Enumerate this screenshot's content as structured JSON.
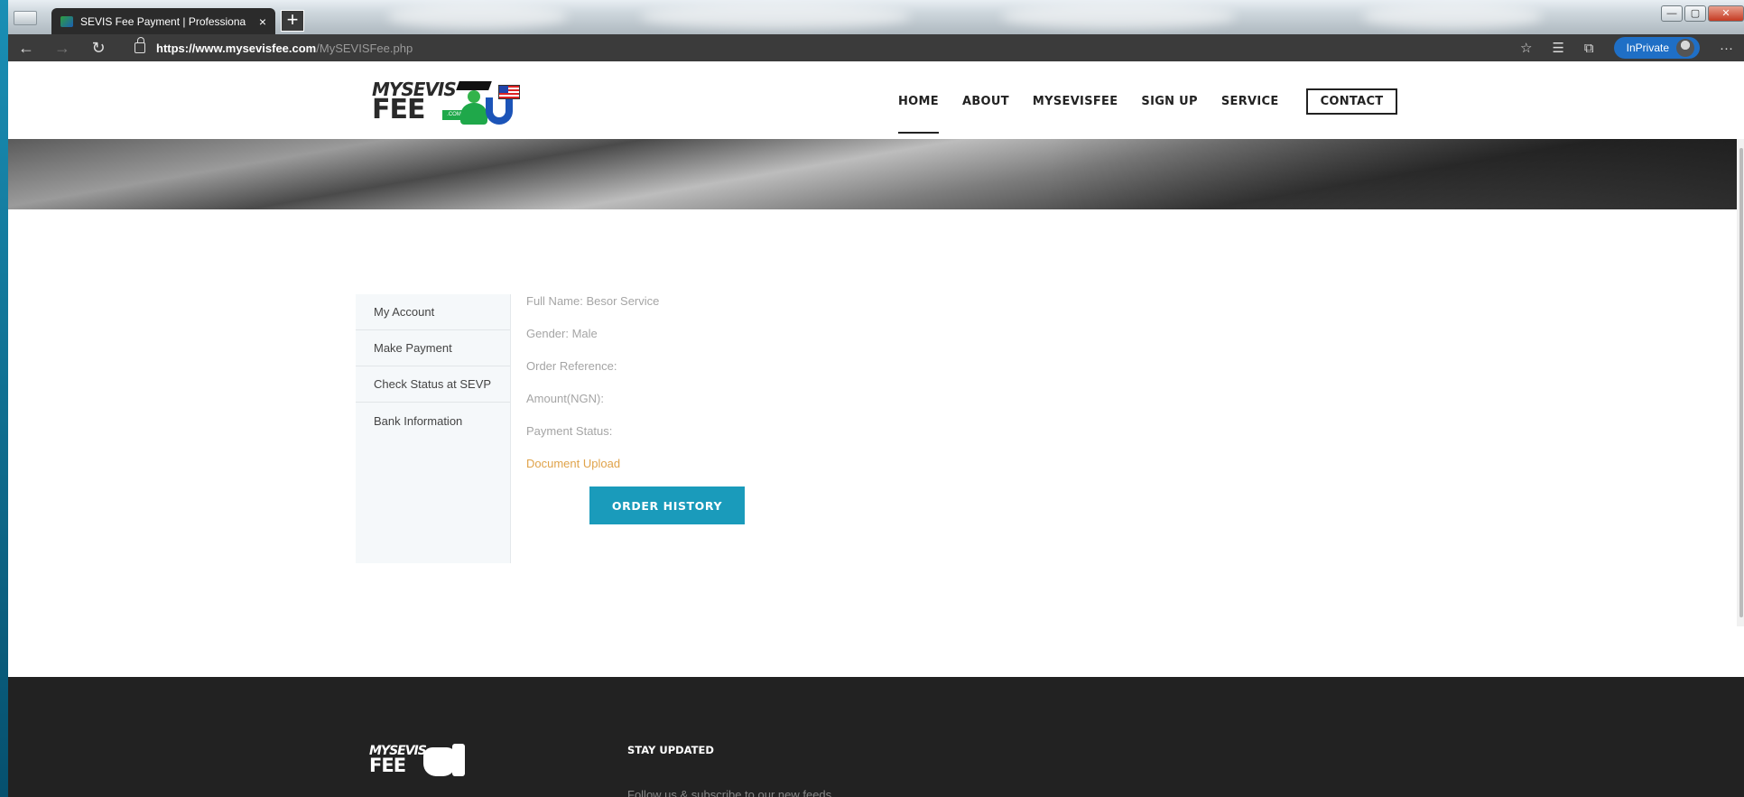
{
  "browser": {
    "tab_title": "SEVIS Fee Payment | Professiona",
    "tab_close": "×",
    "new_tab": "+",
    "url_host": "https://www.mysevisfee.com",
    "url_path": "/MySEVISFee.php",
    "inprivate_label": "InPrivate",
    "more_label": "···",
    "nav": {
      "back": "←",
      "forward": "→",
      "refresh": "↻"
    }
  },
  "site": {
    "logo": {
      "line1": "MYSEVIS",
      "line2": "FEE",
      "com": ".COM"
    },
    "nav": [
      "HOME",
      "ABOUT",
      "MYSEVISFEE",
      "SIGN UP",
      "SERVICE",
      "CONTACT"
    ],
    "active_nav": "HOME"
  },
  "account": {
    "sidebar": [
      "My Account",
      "Make Payment",
      "Check Status at SEVP",
      "Bank Information"
    ],
    "details": {
      "full_name": "Full Name: Besor Service",
      "gender": "Gender: Male",
      "order_reference": "Order Reference:",
      "amount": "Amount(NGN):",
      "payment_status": "Payment Status:",
      "document_upload": "Document Upload"
    },
    "order_history_button": "ORDER HISTORY"
  },
  "footer": {
    "logo": {
      "line1": "MYSEVIS",
      "line2": "FEE"
    },
    "heading": "STAY UPDATED",
    "subtext": "Follow us & subscribe to our new feeds"
  },
  "colors": {
    "accent_button": "#1a9bbb",
    "link_orange": "#e0a34a",
    "footer_bg": "#222222",
    "inprivate_blue": "#1f6fc6"
  }
}
